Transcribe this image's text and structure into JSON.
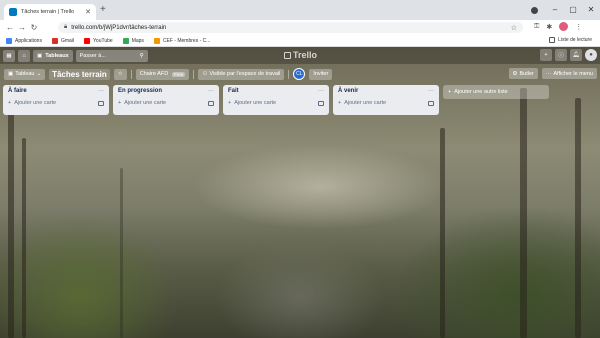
{
  "browser": {
    "tab_title": "Tâches terrain | Trello",
    "url": "trello.com/b/jWjP1dvr/tâches-terrain",
    "bookmarks": [
      {
        "label": "Applications",
        "color": "#4285f4"
      },
      {
        "label": "Gmail",
        "color": "#d93025"
      },
      {
        "label": "YouTube",
        "color": "#ff0000"
      },
      {
        "label": "Maps",
        "color": "#34a853"
      },
      {
        "label": "CEF - Membres - C...",
        "color": "#f29900"
      }
    ],
    "reading_list": "Liste de lecture"
  },
  "topnav": {
    "boards_label": "Tableaux",
    "search_placeholder": "Passer à...",
    "logo": "Trello"
  },
  "board": {
    "boards_btn": "Tableau",
    "title": "Tâches terrain",
    "team": "Chaire AFD",
    "team_badge": "Free",
    "visibility": "Visible par l'espace de travail",
    "member_initials": "CL",
    "invite": "Inviter",
    "butler": "Butler",
    "menu": "Afficher le menu"
  },
  "lists": [
    {
      "name": "À faire",
      "add": "Ajouter une carte"
    },
    {
      "name": "En progression",
      "add": "Ajouter une carte"
    },
    {
      "name": "Fait",
      "add": "Ajouter une carte"
    },
    {
      "name": "À venir",
      "add": "Ajouter une carte"
    }
  ],
  "add_list": "Ajouter une autre liste"
}
